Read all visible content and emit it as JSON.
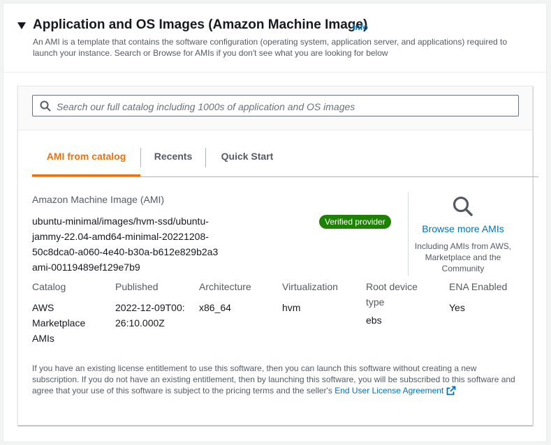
{
  "section": {
    "title": "Application and OS Images (Amazon Machine Image)",
    "info_label": "Info",
    "description": "An AMI is a template that contains the software configuration (operating system, application server, and applications) required to launch your instance. Search or Browse for AMIs if you don't see what you are looking for below"
  },
  "search": {
    "placeholder": "Search our full catalog including 1000s of application and OS images",
    "value": ""
  },
  "tabs": [
    {
      "label": "AMI from catalog",
      "active": true
    },
    {
      "label": "Recents",
      "active": false
    },
    {
      "label": "Quick Start",
      "active": false
    }
  ],
  "ami": {
    "section_label": "Amazon Machine Image (AMI)",
    "name_lines": [
      "ubuntu-minimal/images/hvm-ssd/ubuntu-",
      "jammy-22.04-amd64-minimal-20221208-",
      "50c8dca0-a060-4e40-b30a-b612e829b2a3"
    ],
    "id": "ami-00119489ef129e7b9",
    "badge": "Verified provider",
    "badge_color": "#1d8102"
  },
  "browse": {
    "link": "Browse more AMIs",
    "sub": "Including AMIs from AWS, Marketplace and the Community",
    "icon": "magnifier-icon"
  },
  "details": [
    {
      "label": "Catalog",
      "value": "AWS Marketplace AMIs"
    },
    {
      "label": "Published",
      "value": "2022-12-09T00:26:10.000Z"
    },
    {
      "label": "Architecture",
      "value": "x86_64"
    },
    {
      "label": "Virtualization",
      "value": "hvm"
    },
    {
      "label": "Root device type",
      "value": "ebs"
    },
    {
      "label": "ENA Enabled",
      "value": "Yes"
    }
  ],
  "footnote": {
    "text": "If you have an existing license entitlement to use this software, then you can launch this software without creating a new subscription. If you do not have an existing entitlement, then by launching this software, you will be subscribed to this software and agree that your use of this software is subject to the pricing terms and the seller's",
    "link": "End User License Agreement"
  },
  "colors": {
    "accent": "#ec7211",
    "link": "#0073bb"
  }
}
